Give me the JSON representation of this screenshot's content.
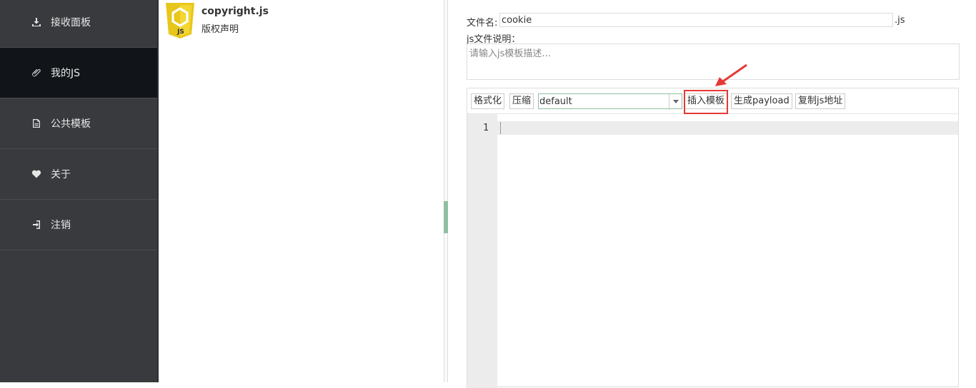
{
  "sidebar": {
    "items": [
      {
        "label": "接收面板",
        "icon": "download-icon",
        "active": false
      },
      {
        "label": "我的JS",
        "icon": "paperclip-icon",
        "active": true
      },
      {
        "label": "公共模板",
        "icon": "document-icon",
        "active": false
      },
      {
        "label": "关于",
        "icon": "heart-icon",
        "active": false
      },
      {
        "label": "注销",
        "icon": "logout-icon",
        "active": false
      }
    ]
  },
  "file_list": {
    "items": [
      {
        "name": "copyright.js",
        "description": "版权声明",
        "badge": "JS"
      }
    ]
  },
  "editor": {
    "filename_label": "文件名:",
    "filename_value": "cookie",
    "filename_suffix": ".js",
    "description_label": "js文件说明：",
    "description_placeholder": "请输入js模板描述...",
    "toolbar": {
      "format_label": "格式化",
      "compress_label": "压缩",
      "theme_value": "default",
      "insert_template_label": "插入模板",
      "generate_payload_label": "生成payload",
      "copy_url_label": "复制js地址"
    },
    "line_numbers": [
      "1"
    ]
  },
  "colors": {
    "sidebar_bg": "#393a3e",
    "sidebar_active_bg": "#111418",
    "highlight": "#e53935",
    "js_logo": "#e8c61a"
  }
}
